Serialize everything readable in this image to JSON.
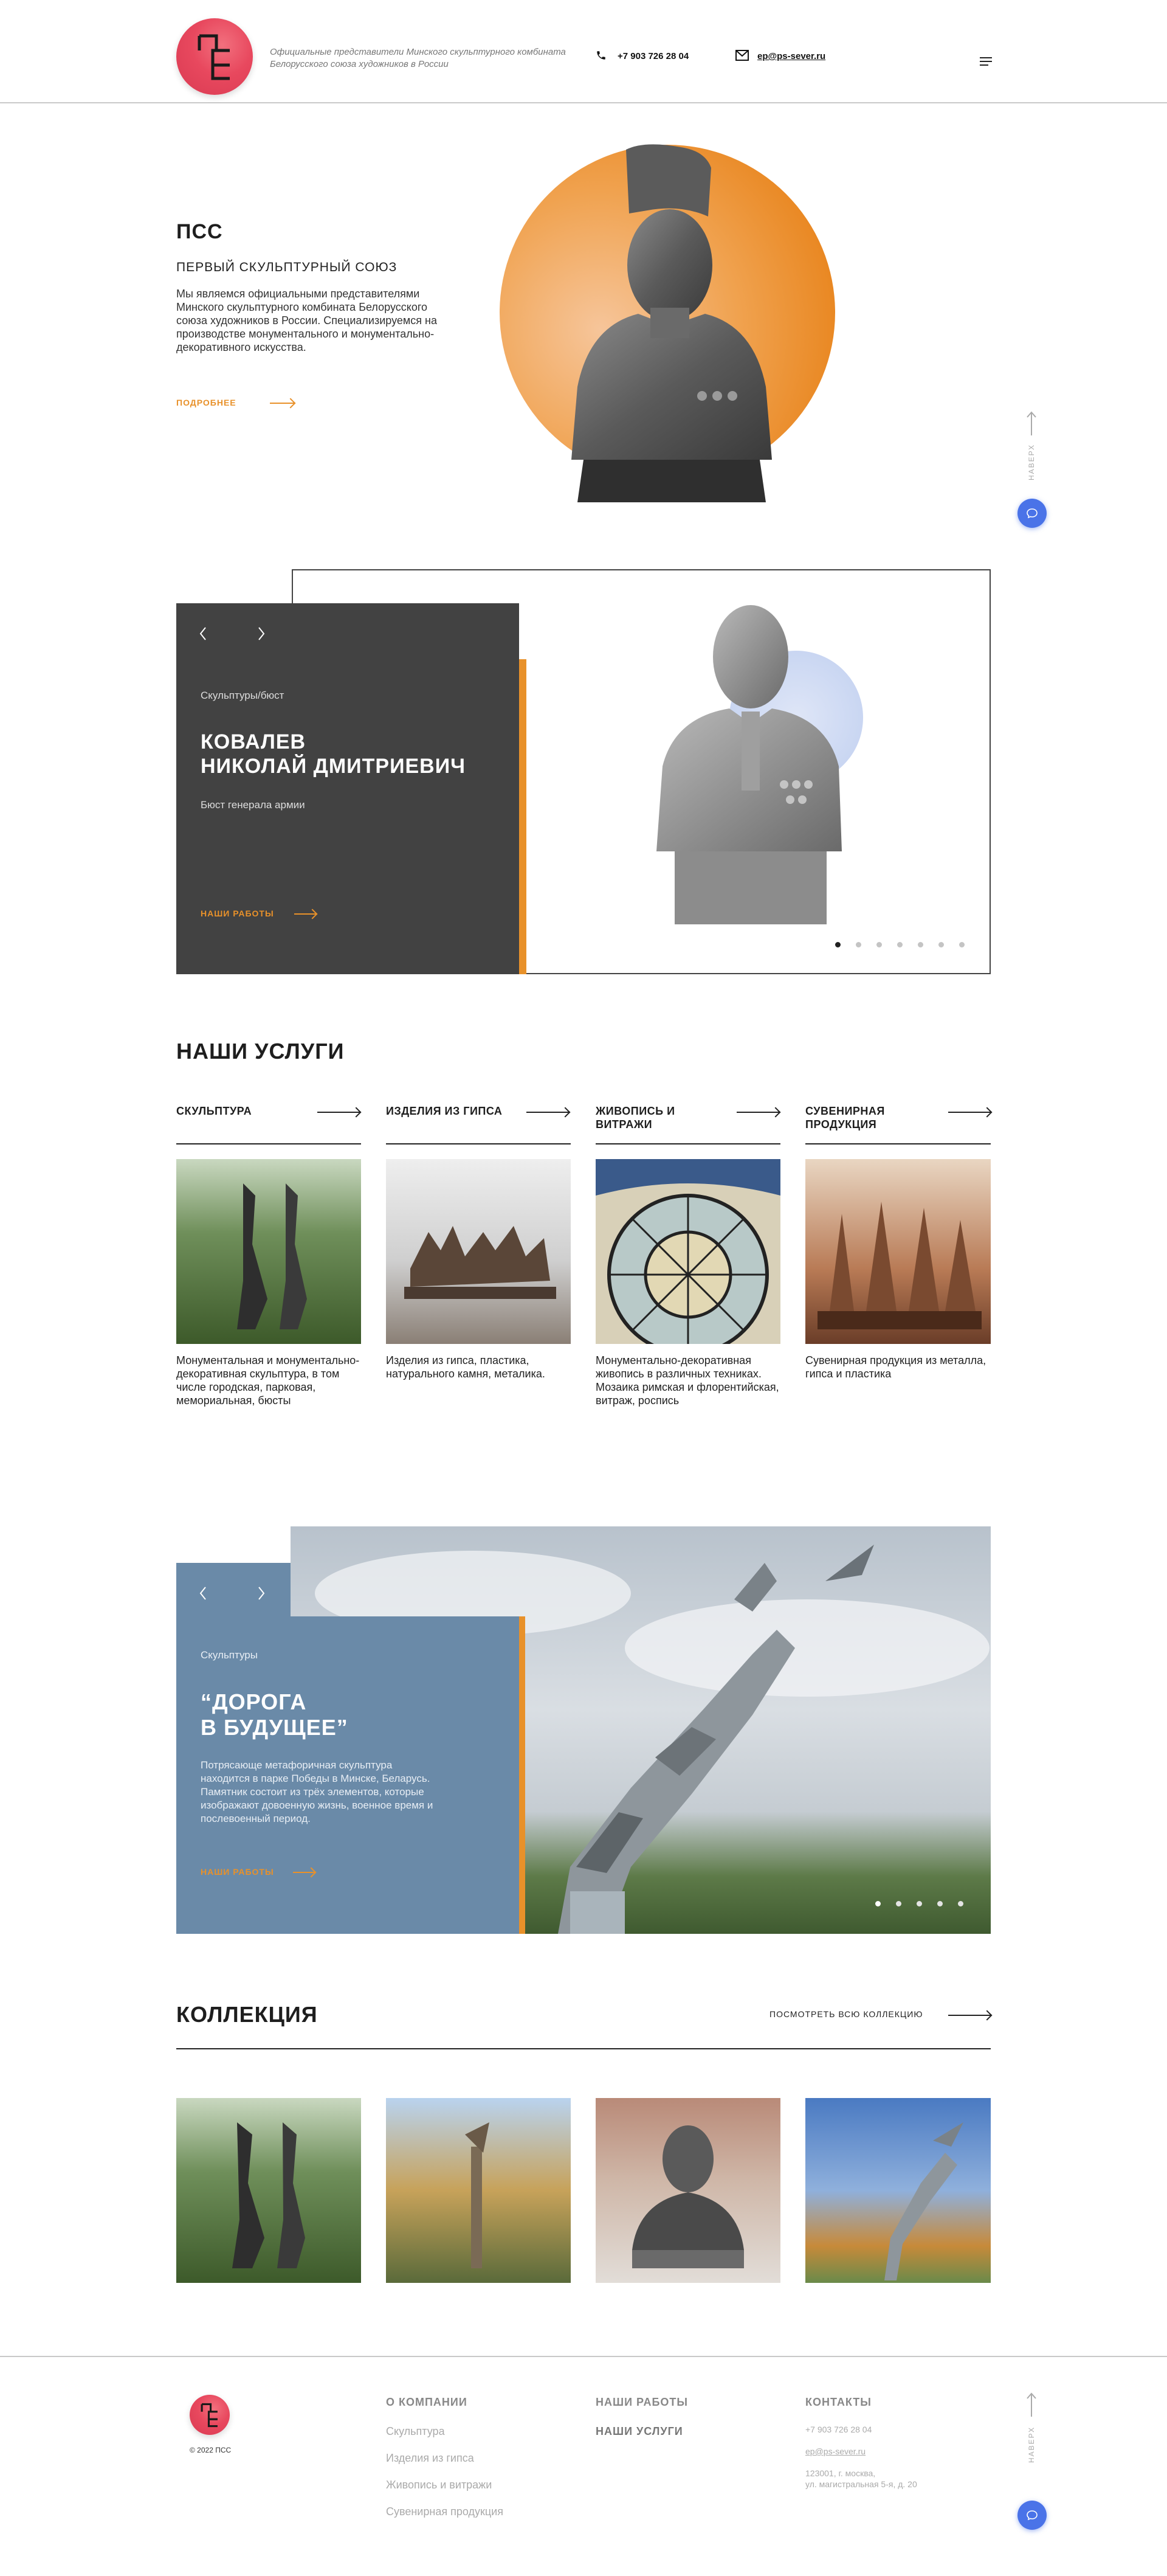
{
  "header": {
    "logo_glyph": "ПСС",
    "tagline_line1": "Официальные представители Минского скульптурного комбината",
    "tagline_line2": "Белорусского союза художников в России",
    "phone": "+7 903 726 28 04",
    "email": "ep@ps-sever.ru",
    "phone_icon": "phone-icon",
    "email_icon": "envelope-icon",
    "menu_icon": "menu-icon"
  },
  "hero": {
    "title": "ПСС",
    "subtitle": "ПЕРВЫЙ СКУЛЬПТУРНЫЙ СОЮЗ",
    "text": "Мы являемся официальными представителями Минского скульптурного комбината Белорусского союза художников в России. Специализируемся на производстве монументального и монументально-декоративного искусства.",
    "more": "ПОДРОБНЕЕ"
  },
  "side_widget": {
    "label": "НАВЕРХ",
    "up_icon": "arrow-up-icon",
    "chat_icon": "chat-icon"
  },
  "slider1": {
    "category": "Скульптуры/бюст",
    "title_line1": "КОВАЛЕВ",
    "title_line2": "НИКОЛАЙ ДМИТРИЕВИЧ",
    "description": "Бюст генерала армии",
    "link": "НАШИ РАБОТЫ",
    "dots_total": 7,
    "active_dot": 1
  },
  "services": {
    "title": "НАШИ УСЛУГИ",
    "items": [
      {
        "title_l1": "СКУЛЬПТУРА",
        "title_l2": "",
        "text": "Монументальная и монументально-декоративная скульптура, в том числе городская, парковая, мемориальная, бюсты"
      },
      {
        "title_l1": "ИЗДЕЛИЯ ИЗ ГИПСА",
        "title_l2": "",
        "text": "Изделия из гипса, пластика, натурального камня, металика."
      },
      {
        "title_l1": "ЖИВОПИСЬ И",
        "title_l2": "ВИТРАЖИ",
        "text": "Монументально-декоративная живопись в различных техниках. Мозаика римская и флорентийская, витраж, роспись"
      },
      {
        "title_l1": "СУВЕНИРНАЯ",
        "title_l2": "ПРОДУКЦИЯ",
        "text": "Сувенирная продукция из металла, гипса и пластика"
      }
    ]
  },
  "slider2": {
    "category": "Скульптуры",
    "title_line1": "“ДОРОГА",
    "title_line2": "В БУДУЩЕЕ”",
    "description": "Потрясающе метафоричная скульптура находится в парке Победы в Минске, Беларусь. Памятник состоит из трёх элементов, которые изображают довоенную жизнь, военное время и послевоенный период.",
    "link": "НАШИ РАБОТЫ",
    "dots_total": 5,
    "active_dot": 1
  },
  "collection": {
    "title": "КОЛЛЕКЦИЯ",
    "see_all": "ПОСМОТРЕТЬ ВСЮ КОЛЛЕКЦИЮ"
  },
  "footer": {
    "copyright": "© 2022 ПСС",
    "company_head": "О КОМПАНИИ",
    "company_links": [
      "Скульптура",
      "Изделия из гипса",
      "Живопись и витражи",
      "Сувенирная продукция"
    ],
    "works_head": "НАШИ РАБОТЫ",
    "services_head": "НАШИ УСЛУГИ",
    "contacts_head": "КОНТАКТЫ",
    "phone": "+7 903 726 28 04",
    "email": "ep@ps-sever.ru",
    "address_l1": "123001, г. москва,",
    "address_l2": "ул. магистральная 5-я, д. 20"
  },
  "colors": {
    "accent_orange": "#e8912a",
    "dark_card": "#424242",
    "blue_card": "#6a8aa8",
    "chat_blue": "#4a73e8",
    "logo_red": "#e8485e"
  }
}
